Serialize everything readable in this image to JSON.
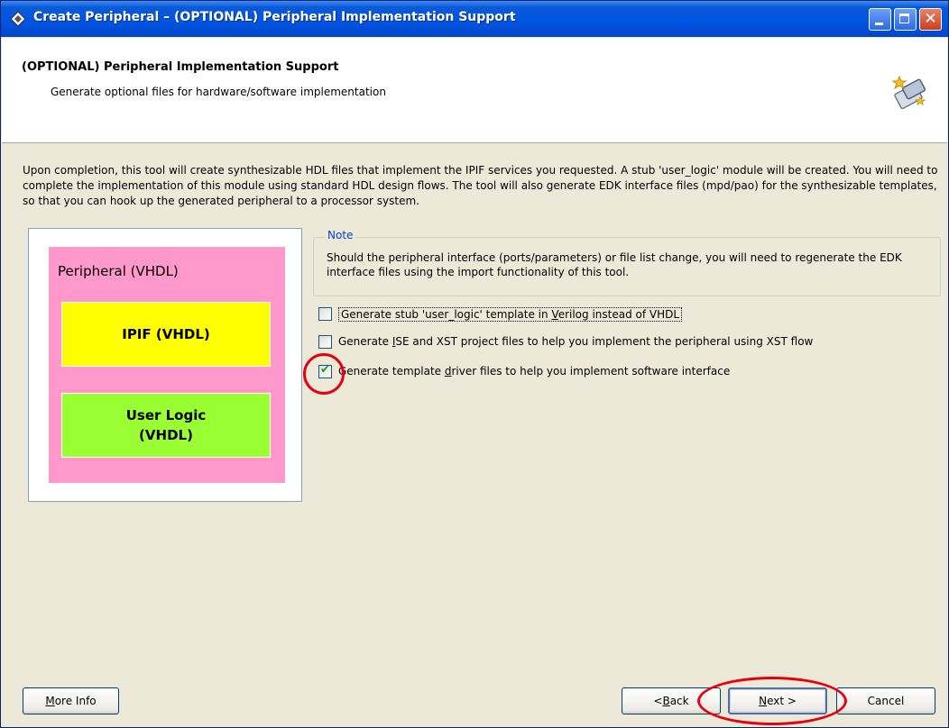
{
  "window": {
    "title": "Create Peripheral – (OPTIONAL) Peripheral Implementation Support",
    "close_glyph": "✕"
  },
  "header": {
    "title": "(OPTIONAL) Peripheral Implementation Support",
    "subtitle": "Generate optional files for hardware/software implementation",
    "icon": "wizard-icon"
  },
  "intro_text": "Upon completion, this tool will create synthesizable HDL files that implement the IPIF services you requested. A stub 'user_logic' module will be created. You will need to complete the implementation of this module using standard HDL design flows. The tool will also generate EDK interface files (mpd/pao) for the synthesizable templates, so that you can hook up the generated peripheral to a processor system.",
  "diagram": {
    "peripheral_label": "Peripheral (VHDL)",
    "ipif_label": "IPIF (VHDL)",
    "user_logic_line1": "User Logic",
    "user_logic_line2": "(VHDL)",
    "colors": {
      "peripheral": "#ff99cc",
      "ipif": "#ffff00",
      "user_logic": "#99ff33"
    }
  },
  "note": {
    "legend": "Note",
    "text": "Should the peripheral interface (ports/parameters) or file list change, you will need to regenerate the EDK interface files using the import functionality of this tool."
  },
  "options": [
    {
      "pre": "Generate stub 'user_logic' template in ",
      "key": "V",
      "post": "erilog instead of VHDL",
      "checked": false
    },
    {
      "pre": "Generate ",
      "key": "I",
      "post": "SE and XST project files to help you implement the peripheral using XST flow",
      "checked": false
    },
    {
      "pre": "Generate template ",
      "key": "d",
      "post": "river files to help you implement software interface",
      "checked": true
    }
  ],
  "buttons": {
    "more_info_key": "M",
    "more_info_rest": "ore Info",
    "back_prefix": "< ",
    "back_key": "B",
    "back_rest": "ack",
    "next_key": "N",
    "next_rest": "ext >",
    "cancel": "Cancel"
  },
  "check_glyph": "✔",
  "highlight_color": "#e60012"
}
